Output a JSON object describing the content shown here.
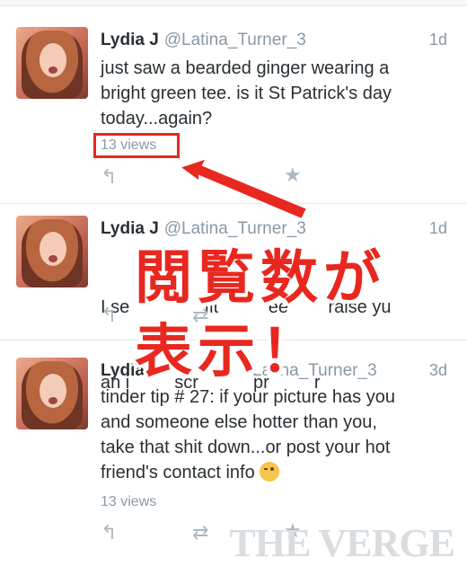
{
  "tweets": [
    {
      "name": "Lydia J",
      "handle": "@Latina_Turner_3",
      "time": "1d",
      "lines": [
        "just saw a bearded ginger wearing a",
        "bright green tee. is it St Patrick's day",
        "today...again?"
      ],
      "views": "13 views"
    },
    {
      "name": "Lydia J",
      "handle": "@Latina_Turner_3",
      "time": "1d",
      "lines": [
        "I se               fit          ee        raise yu",
        "an i         scr           pr         r"
      ],
      "views": ""
    },
    {
      "name": "Lydia",
      "handle": "Latina_Turner_3",
      "time": "3d",
      "lines": [
        "tinder tip # 27:  if your picture has you",
        "and someone else hotter than you,",
        "take that shit down...or post your hot",
        "friend's contact info"
      ],
      "views": "13 views"
    }
  ],
  "annotation": {
    "line1": "閲覧数が",
    "line2": "表示！"
  },
  "icons": {
    "reply": "reply-icon",
    "retweet": "retweet-icon",
    "favorite": "star-icon",
    "wink": "wink-emoji-icon"
  },
  "colors": {
    "accent": "#e8281f",
    "muted": "#8899a6"
  },
  "watermark": "THE VERGE"
}
